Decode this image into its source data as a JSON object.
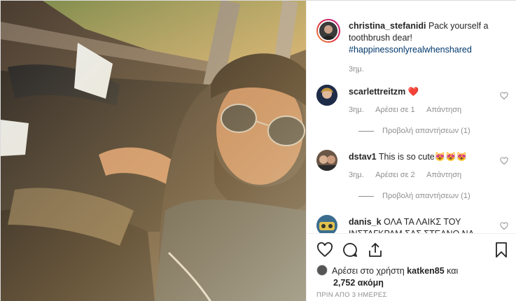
{
  "post": {
    "author": "christina_stefanidi",
    "caption": "Pack yourself a toothbrush dear!",
    "hashtag": "#happinessonlyrealwhenshared",
    "time": "3ημ."
  },
  "comments": [
    {
      "user": "scarlettreitzm",
      "text": "❤️",
      "time": "3ημ.",
      "likes": "Αρέσει σε 1",
      "reply": "Απάντηση",
      "view_replies": "Προβολή απαντήσεων (1)",
      "avatar_color": "#2a3a5a"
    },
    {
      "user": "dstav1",
      "text": "This is so cute😻😻😻",
      "time": "3ημ.",
      "likes": "Αρέσει σε 2",
      "reply": "Απάντηση",
      "view_replies": "Προβολή απαντήσεων (1)",
      "avatar_color": "#6a5646"
    },
    {
      "user": "danis_k",
      "text": "ΟΛΑ ΤΑ ΛΑΙΚΣ ΤΟΥ ΙΝΣΤΑΓΚΡΑΜ ΣΑΣ ΣΤΕΛΝΟ ΝΑ",
      "avatar_color": "#3b6d8f"
    }
  ],
  "liked_by": {
    "prefix": "Αρέσει στο χρήστη",
    "user": "katken85",
    "joiner": "και",
    "count_text": "2,752 ακόμη"
  },
  "timestamp": "ΠΡΙΝ ΑΠΟ 3 ΗΜΕΡΕΣ",
  "colors": {
    "accent": "#00376b",
    "muted": "#8e8e8e",
    "heart": "#ed4956"
  }
}
